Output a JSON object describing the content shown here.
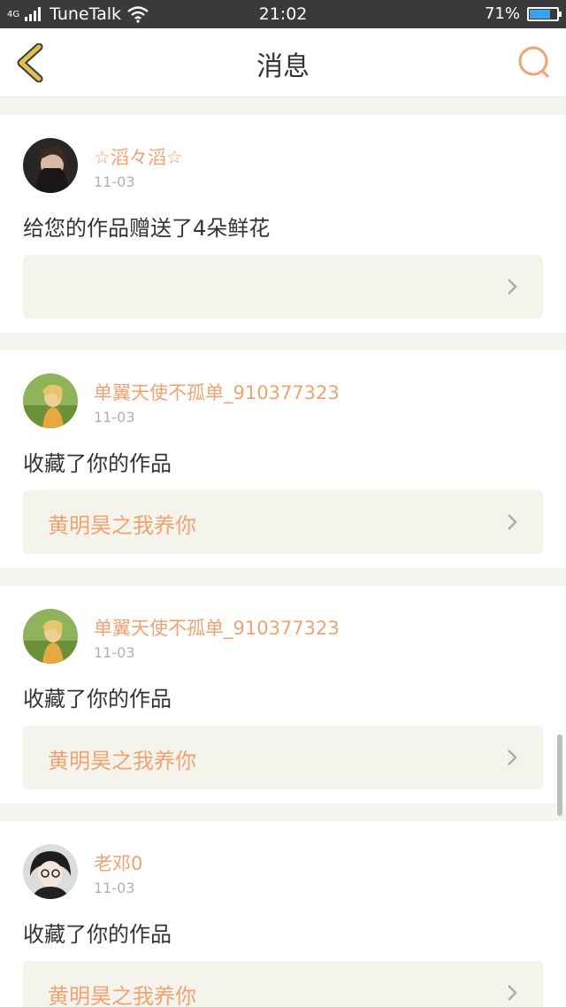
{
  "status": {
    "network": "4G",
    "carrier": "TuneTalk",
    "time": "21:02",
    "battery": "71%",
    "battery_level": 0.71
  },
  "header": {
    "title": "消息",
    "back_icon": "chevron-left-icon",
    "search_icon": "search-icon"
  },
  "messages": [
    {
      "user": "☆滔々滔☆",
      "date": "11-03",
      "action": "给您的作品赠送了4朵鲜花",
      "work": ""
    },
    {
      "user": "单翼天使不孤单_910377323",
      "date": "11-03",
      "action": "收藏了你的作品",
      "work": "黄明昊之我养你"
    },
    {
      "user": "单翼天使不孤单_910377323",
      "date": "11-03",
      "action": "收藏了你的作品",
      "work": "黄明昊之我养你"
    },
    {
      "user": "老邓0",
      "date": "11-03",
      "action": "收藏了你的作品",
      "work": "黄明昊之我养你"
    }
  ],
  "colors": {
    "accent": "#f0a272",
    "back_icon": "#e0c050",
    "status_bar": "#3a3a3a"
  }
}
